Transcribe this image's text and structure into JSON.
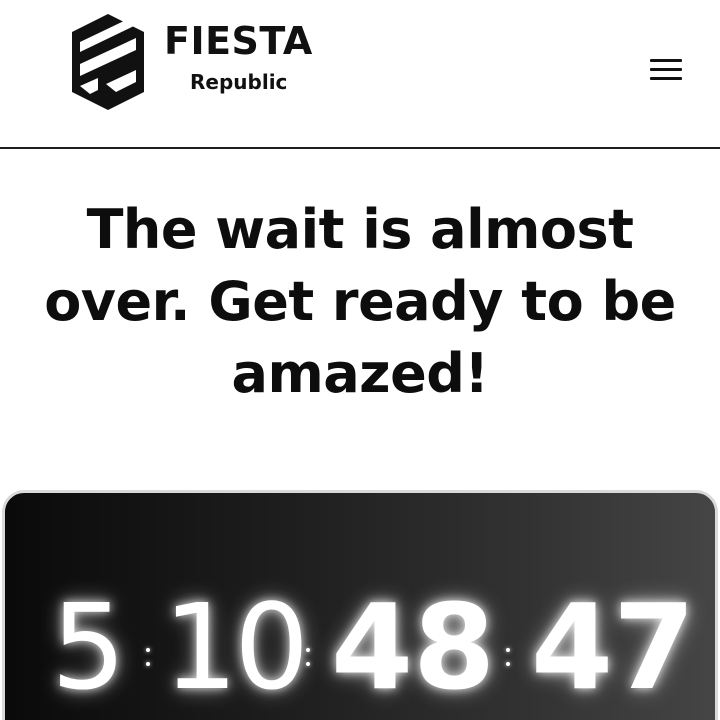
{
  "header": {
    "brand_name": "FIESTA",
    "brand_tagline": "Republic",
    "menu_icon": "hamburger-menu-icon"
  },
  "hero": {
    "headline": "The wait is almost over. Get ready to be amazed!"
  },
  "countdown": {
    "days": "5",
    "hours": "10",
    "minutes": "48",
    "seconds": "47"
  },
  "colors": {
    "text": "#0d0d0d",
    "card_dark": "#0a0a0a",
    "card_light": "#454545",
    "digits": "#ffffff"
  }
}
